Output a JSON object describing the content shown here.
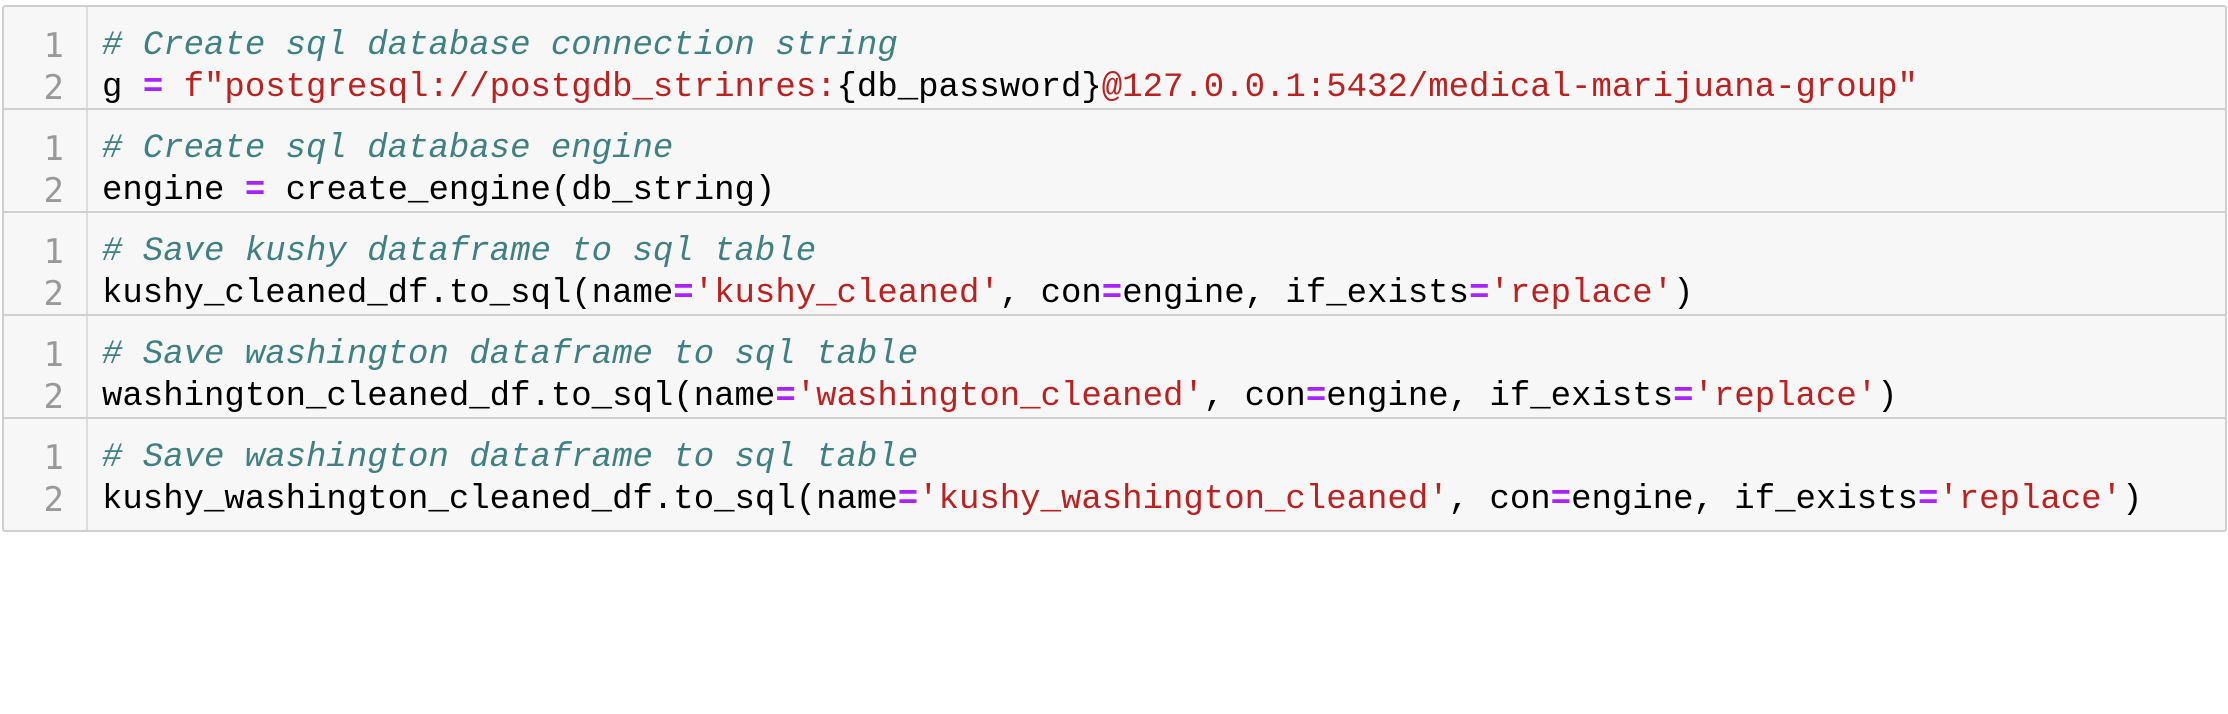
{
  "cells": [
    {
      "line_numbers": [
        "1",
        "2"
      ],
      "lines": [
        [
          {
            "t": "comment",
            "v": "# Create sql database connection string"
          }
        ],
        [
          {
            "t": "plain",
            "v": "g "
          },
          {
            "t": "op",
            "v": "="
          },
          {
            "t": "plain",
            "v": " "
          },
          {
            "t": "string",
            "v": "f\"postgresql://postgdb_strinres:"
          },
          {
            "t": "interp",
            "v": "{db_password}"
          },
          {
            "t": "string",
            "v": "@127.0.0.1:5432/medical-marijuana-group\""
          }
        ]
      ]
    },
    {
      "line_numbers": [
        "1",
        "2"
      ],
      "lines": [
        [
          {
            "t": "comment",
            "v": "# Create sql database engine"
          }
        ],
        [
          {
            "t": "plain",
            "v": "engine "
          },
          {
            "t": "op",
            "v": "="
          },
          {
            "t": "plain",
            "v": " create_engine(db_string)"
          }
        ]
      ]
    },
    {
      "line_numbers": [
        "1",
        "2"
      ],
      "lines": [
        [
          {
            "t": "comment",
            "v": "# Save kushy dataframe to sql table"
          }
        ],
        [
          {
            "t": "plain",
            "v": "kushy_cleaned_df.to_sql(name"
          },
          {
            "t": "op",
            "v": "="
          },
          {
            "t": "string",
            "v": "'kushy_cleaned'"
          },
          {
            "t": "plain",
            "v": ", con"
          },
          {
            "t": "op",
            "v": "="
          },
          {
            "t": "plain",
            "v": "engine, if_exists"
          },
          {
            "t": "op",
            "v": "="
          },
          {
            "t": "string",
            "v": "'replace'"
          },
          {
            "t": "plain",
            "v": ")"
          }
        ]
      ]
    },
    {
      "line_numbers": [
        "1",
        "2"
      ],
      "lines": [
        [
          {
            "t": "comment",
            "v": "# Save washington dataframe to sql table"
          }
        ],
        [
          {
            "t": "plain",
            "v": "washington_cleaned_df.to_sql(name"
          },
          {
            "t": "op",
            "v": "="
          },
          {
            "t": "string",
            "v": "'washington_cleaned'"
          },
          {
            "t": "plain",
            "v": ", con"
          },
          {
            "t": "op",
            "v": "="
          },
          {
            "t": "plain",
            "v": "engine, if_exists"
          },
          {
            "t": "op",
            "v": "="
          },
          {
            "t": "string",
            "v": "'replace'"
          },
          {
            "t": "plain",
            "v": ")"
          }
        ]
      ]
    },
    {
      "line_numbers": [
        "1",
        "2"
      ],
      "lines": [
        [
          {
            "t": "comment",
            "v": "# Save washington dataframe to sql table"
          }
        ],
        [
          {
            "t": "plain",
            "v": "kushy_washington_cleaned_df.to_sql(name"
          },
          {
            "t": "op",
            "v": "="
          },
          {
            "t": "string",
            "v": "'kushy_washington_cleaned'"
          },
          {
            "t": "plain",
            "v": ", con"
          },
          {
            "t": "op",
            "v": "="
          },
          {
            "t": "plain",
            "v": "engine, if_exists"
          },
          {
            "t": "op",
            "v": "="
          },
          {
            "t": "string",
            "v": "'replace'"
          },
          {
            "t": "plain",
            "v": ")"
          }
        ]
      ]
    }
  ],
  "colors": {
    "comment": "#408080",
    "string": "#ba2121",
    "operator": "#aa22ff",
    "line_number": "#999999",
    "cell_background": "#f7f7f7",
    "cell_border": "#cfcfcf"
  }
}
